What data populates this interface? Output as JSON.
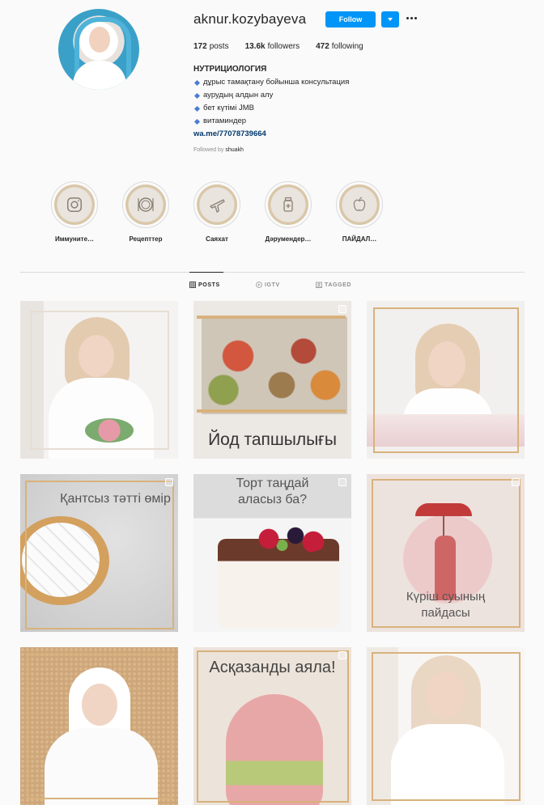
{
  "profile": {
    "username": "aknur.kozybayeva",
    "follow_label": "Follow",
    "stats": {
      "posts_count": "172",
      "posts_label": "posts",
      "followers_count": "13.6k",
      "followers_label": "followers",
      "following_count": "472",
      "following_label": "following"
    },
    "bio": {
      "title": "НУТРИЦИОЛОГИЯ",
      "lines": [
        "дұрыс тамақтану бойынша консультация",
        "аурудың алдын алу",
        "бет күтімі JMB",
        "витаминдер"
      ],
      "link": "wa.me/77078739664"
    },
    "followed_by_prefix": "Followed by",
    "followed_by_user": "shuakh"
  },
  "highlights": [
    {
      "label": "Иммуните…",
      "icon": "instagram-icon"
    },
    {
      "label": "Рецепттер",
      "icon": "plate-cutlery-icon"
    },
    {
      "label": "Саяхат",
      "icon": "airplane-icon"
    },
    {
      "label": "Дәрумендер…",
      "icon": "medicine-jar-icon"
    },
    {
      "label": "ПАЙДАЛ…",
      "icon": "apple-icon"
    }
  ],
  "tabs": [
    {
      "label": "POSTS",
      "active": true,
      "icon": "grid-icon"
    },
    {
      "label": "IGTV",
      "active": false,
      "icon": "igtv-icon"
    },
    {
      "label": "TAGGED",
      "active": false,
      "icon": "tag-icon"
    }
  ],
  "posts": [
    {
      "kind": "photo",
      "text": ""
    },
    {
      "kind": "carousel",
      "text": "Йод тапшылығы"
    },
    {
      "kind": "photo",
      "text": ""
    },
    {
      "kind": "carousel",
      "text": "Қантсыз тәтті өмір"
    },
    {
      "kind": "carousel",
      "text": "Торт таңдай аласыз ба?"
    },
    {
      "kind": "carousel",
      "text": "Күріш суының пайдасы"
    },
    {
      "kind": "photo",
      "text": ""
    },
    {
      "kind": "carousel",
      "text": "Асқазанды аяла!"
    },
    {
      "kind": "photo",
      "text": ""
    }
  ],
  "colors": {
    "accent": "#0095f6",
    "gold_frame": "#d8b27c",
    "link": "#00376b"
  }
}
